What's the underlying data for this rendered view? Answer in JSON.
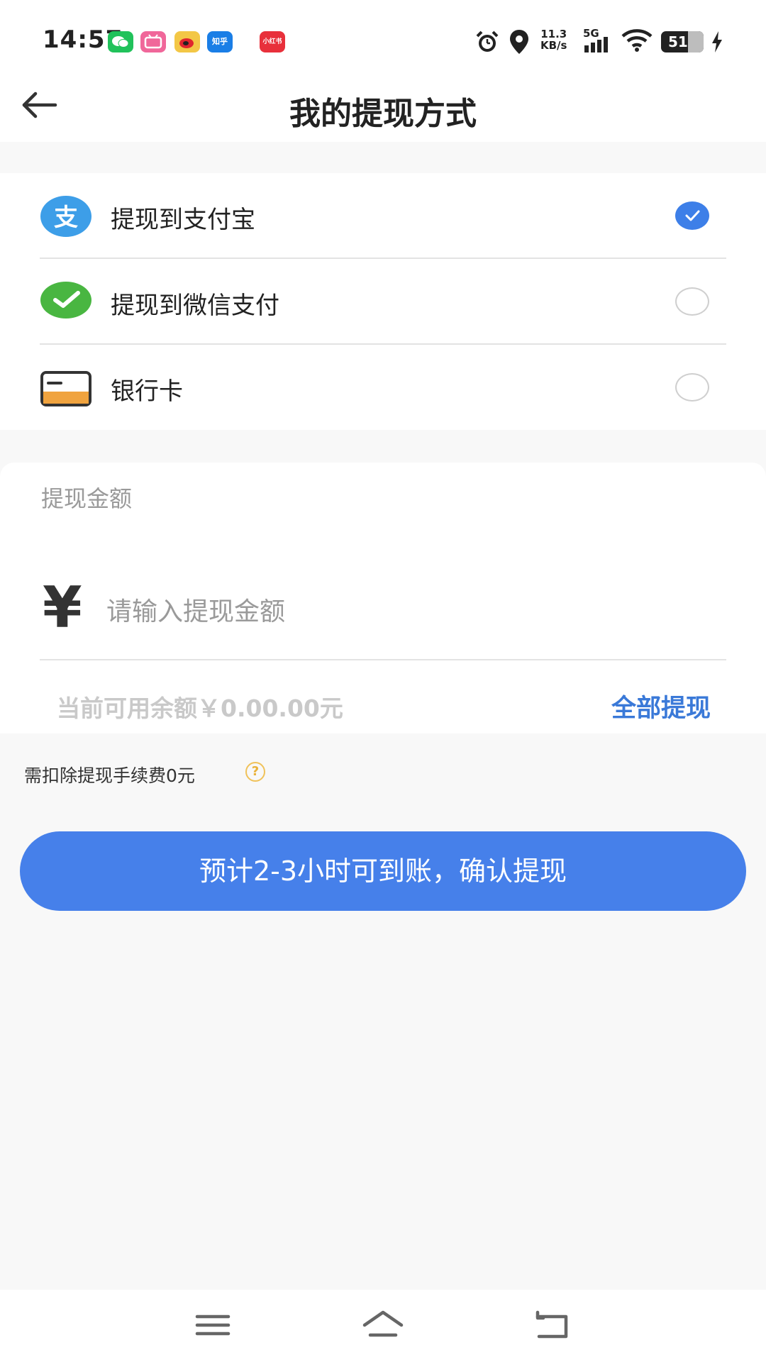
{
  "status_bar": {
    "time": "14:57",
    "net_speed_value": "11.3",
    "net_speed_unit": "KB/s",
    "network": "5G",
    "battery": "51",
    "notifications": [
      {
        "app": "wechat",
        "color": "#21c25b"
      },
      {
        "app": "bilibili",
        "color": "#f0679a"
      },
      {
        "app": "weibo",
        "color": "#f3c746"
      },
      {
        "app": "zhihu",
        "color": "#1a7ee6",
        "label": "知乎"
      },
      {
        "app": "xiaohongshu",
        "color": "#e8303b",
        "label": "小红书"
      }
    ]
  },
  "header": {
    "title": "我的提现方式"
  },
  "methods": [
    {
      "label": "提现到支付宝",
      "icon": "alipay-icon",
      "selected": true
    },
    {
      "label": "提现到微信支付",
      "icon": "wechat-pay-icon",
      "selected": false
    },
    {
      "label": "银行卡",
      "icon": "bank-card-icon",
      "selected": false
    }
  ],
  "amount": {
    "title": "提现金额",
    "currency": "¥",
    "placeholder": "请输入提现金额",
    "balance_text": "当前可用余额￥0.00.00元",
    "withdraw_all": "全部提现"
  },
  "fee": {
    "text": "需扣除提现手续费0元",
    "help": "?"
  },
  "confirm": {
    "label": "预计2-3小时可到账，确认提现"
  },
  "colors": {
    "accent": "#4680ea",
    "link": "#3a79d8",
    "help": "#f0c25a"
  }
}
